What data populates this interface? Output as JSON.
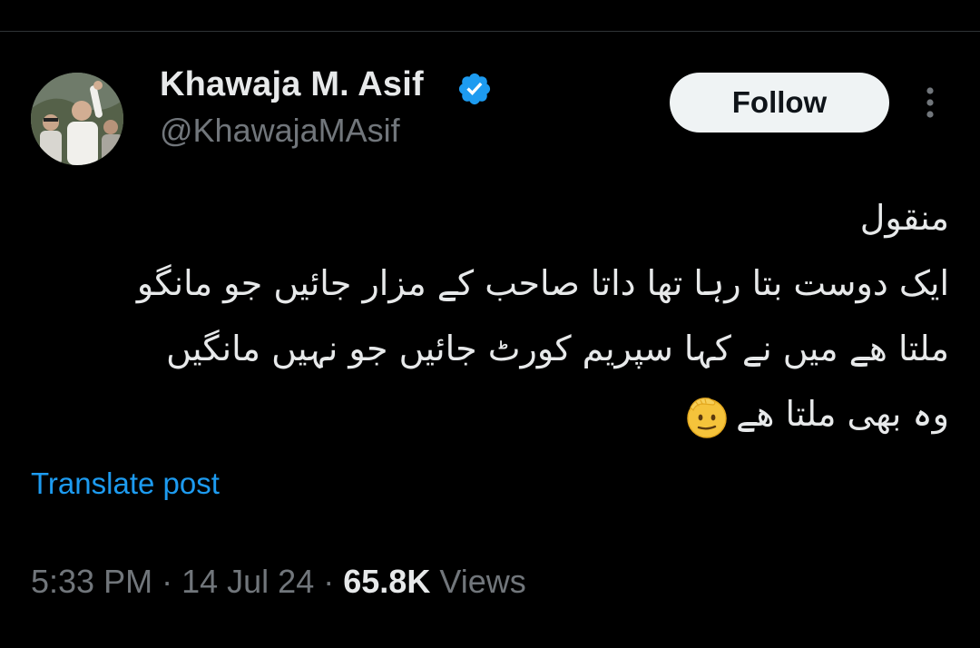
{
  "author": {
    "display_name": "Khawaja M. Asif",
    "handle": "@KhawajaMAsif",
    "verified": true,
    "avatar_icon": "profile-photo"
  },
  "actions": {
    "follow_label": "Follow",
    "more_icon": "more-vertical-icon"
  },
  "tweet": {
    "lines": [
      "منقول",
      "ایک دوست بتا رہا تھا داتا صاحب کے مزار جائیں جو مانگو",
      "ملتا ھے میں نے کہا سپریم کورٹ جائیں جو نہیں مانگیں",
      "وہ بھی ملتا ھے"
    ],
    "emoji": "saluting-face-icon"
  },
  "translate_label": "Translate post",
  "meta": {
    "time": "5:33 PM",
    "separator": "·",
    "date": "14 Jul 24",
    "views_count": "65.8K",
    "views_label": "Views"
  },
  "colors": {
    "background": "#000000",
    "text_primary": "#e7e9ea",
    "text_secondary": "#71767b",
    "accent_blue": "#1d9bf0",
    "follow_bg": "#eff3f4"
  }
}
